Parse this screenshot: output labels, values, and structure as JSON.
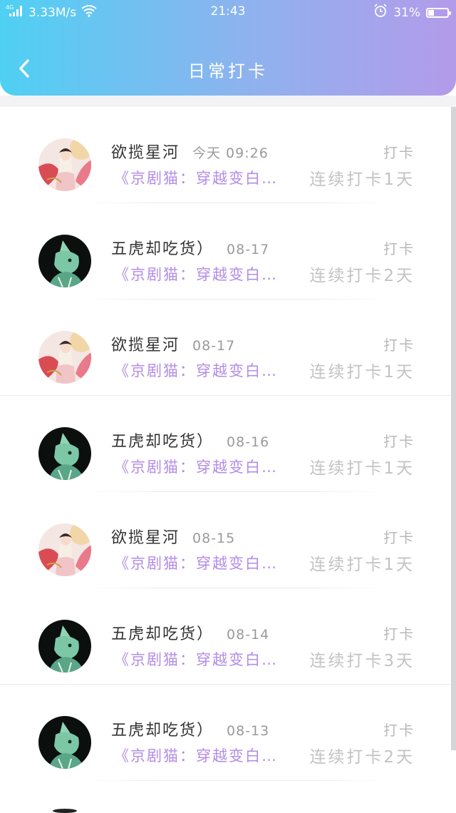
{
  "status_bar": {
    "network": "4G",
    "speed": "3.33M/s",
    "time": "21:43",
    "battery": "31%",
    "battery_level": 0.31
  },
  "header": {
    "title": "日常打卡"
  },
  "items": [
    {
      "name": "欲揽星河",
      "time": "今天 09:26",
      "action": "打卡",
      "book": "《京剧猫：穿越变白…",
      "streak": "连续打卡1天",
      "avatar": "fairy"
    },
    {
      "name": "五虎却吃货）",
      "time": "08-17",
      "action": "打卡",
      "book": "《京剧猫：穿越变白…",
      "streak": "连续打卡2天",
      "avatar": "cat"
    },
    {
      "name": "欲揽星河",
      "time": "08-17",
      "action": "打卡",
      "book": "《京剧猫：穿越变白…",
      "streak": "连续打卡1天",
      "avatar": "fairy"
    },
    {
      "name": "五虎却吃货）",
      "time": "08-16",
      "action": "打卡",
      "book": "《京剧猫：穿越变白…",
      "streak": "连续打卡1天",
      "avatar": "cat"
    },
    {
      "name": "欲揽星河",
      "time": "08-15",
      "action": "打卡",
      "book": "《京剧猫：穿越变白…",
      "streak": "连续打卡1天",
      "avatar": "fairy"
    },
    {
      "name": "五虎却吃货）",
      "time": "08-14",
      "action": "打卡",
      "book": "《京剧猫：穿越变白…",
      "streak": "连续打卡3天",
      "avatar": "cat"
    },
    {
      "name": "五虎却吃货）",
      "time": "08-13",
      "action": "打卡",
      "book": "《京剧猫：穿越变白…",
      "streak": "连续打卡2天",
      "avatar": "cat"
    }
  ]
}
